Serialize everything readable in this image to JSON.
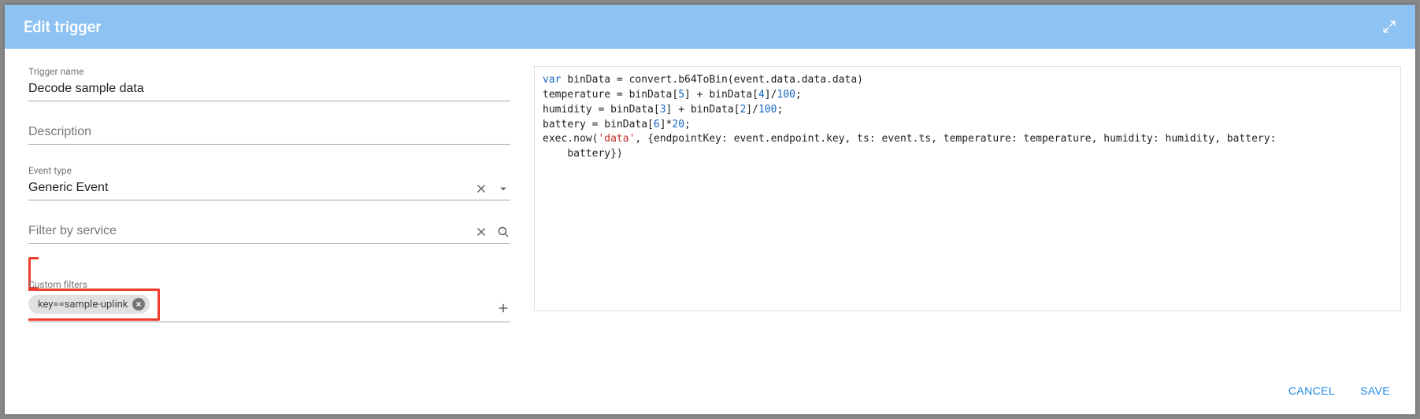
{
  "header": {
    "title": "Edit trigger"
  },
  "form": {
    "trigger_name": {
      "label": "Trigger name",
      "value": "Decode sample data"
    },
    "description": {
      "label": "Description",
      "placeholder": "Description",
      "value": ""
    },
    "event_type": {
      "label": "Event type",
      "value": "Generic Event"
    },
    "filter_by_service": {
      "placeholder": "Filter by service",
      "value": ""
    },
    "custom_filters": {
      "label": "Custom filters",
      "chips": [
        "key==sample-uplink"
      ]
    }
  },
  "code": {
    "lines": [
      {
        "segments": [
          {
            "t": "var ",
            "c": "kw"
          },
          {
            "t": "binData = convert.b64ToBin(event.data.data.data)"
          }
        ]
      },
      {
        "segments": [
          {
            "t": "temperature = binData["
          },
          {
            "t": "5",
            "c": "num"
          },
          {
            "t": "] + binData["
          },
          {
            "t": "4",
            "c": "num"
          },
          {
            "t": "]/"
          },
          {
            "t": "100",
            "c": "num"
          },
          {
            "t": ";"
          }
        ]
      },
      {
        "segments": [
          {
            "t": "humidity = binData["
          },
          {
            "t": "3",
            "c": "num"
          },
          {
            "t": "] + binData["
          },
          {
            "t": "2",
            "c": "num"
          },
          {
            "t": "]/"
          },
          {
            "t": "100",
            "c": "num"
          },
          {
            "t": ";"
          }
        ]
      },
      {
        "segments": [
          {
            "t": "battery = binData["
          },
          {
            "t": "6",
            "c": "num"
          },
          {
            "t": "]*"
          },
          {
            "t": "20",
            "c": "num"
          },
          {
            "t": ";"
          }
        ]
      },
      {
        "segments": [
          {
            "t": "exec.now("
          },
          {
            "t": "'data'",
            "c": "str"
          },
          {
            "t": ", {endpointKey: event.endpoint.key, ts: event.ts, temperature: temperature, humidity: humidity, battery:"
          }
        ]
      },
      {
        "segments": [
          {
            "t": "    battery})"
          }
        ]
      }
    ]
  },
  "footer": {
    "cancel": "CANCEL",
    "save": "SAVE"
  }
}
